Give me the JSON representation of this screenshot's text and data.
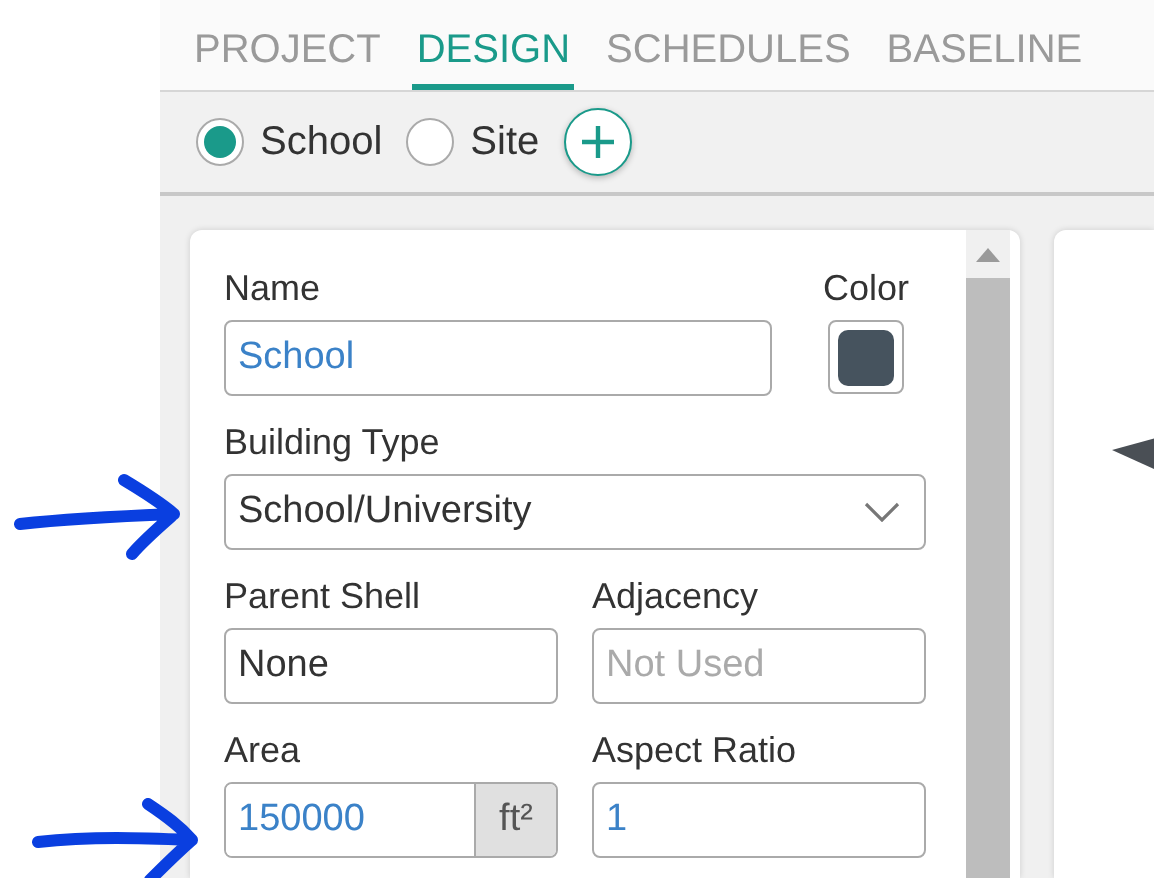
{
  "tabs": [
    {
      "label": "PROJECT",
      "selected": false
    },
    {
      "label": "DESIGN",
      "selected": true
    },
    {
      "label": "SCHEDULES",
      "selected": false
    },
    {
      "label": "BASELINE",
      "selected": false
    }
  ],
  "toolbar": {
    "options": [
      {
        "label": "School",
        "selected": true
      },
      {
        "label": "Site",
        "selected": false
      }
    ]
  },
  "form": {
    "name": {
      "label": "Name",
      "value": "School"
    },
    "color": {
      "label": "Color",
      "color": "#46535e"
    },
    "building_type": {
      "label": "Building Type",
      "value": "School/University"
    },
    "parent_shell": {
      "label": "Parent Shell",
      "value": "None"
    },
    "adjacency": {
      "label": "Adjacency",
      "placeholder": "Not Used"
    },
    "area": {
      "label": "Area",
      "value": "150000",
      "unit": "ft²"
    },
    "aspect_ratio": {
      "label": "Aspect Ratio",
      "value": "1"
    }
  }
}
